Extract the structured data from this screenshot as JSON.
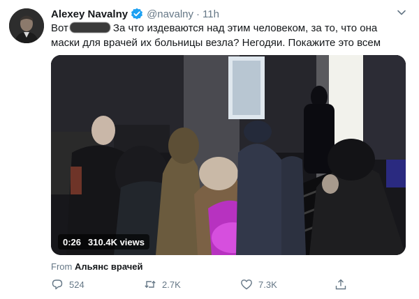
{
  "author": {
    "name": "Alexey Navalny",
    "handle": "@navalny",
    "separator": "·",
    "time": "11h"
  },
  "tweet": {
    "text_before_redaction": "Вот",
    "text_after_redaction": "За что издеваются над этим человеком, за то, что она маски для врачей их больницы везла? Негодяи. Покажите это всем"
  },
  "video": {
    "duration": "0:26",
    "views": "310.4K views"
  },
  "source": {
    "prefix": "From",
    "name": "Альянс врачей"
  },
  "actions": {
    "replies": "524",
    "retweets": "2.7K",
    "likes": "7.3K"
  },
  "icons": {
    "verified": "verified-badge-icon",
    "menu": "chevron-down-icon",
    "reply": "reply-icon",
    "retweet": "retweet-icon",
    "like": "heart-icon",
    "share": "share-icon"
  },
  "colors": {
    "verified": "#1da1f2",
    "muted": "#657786",
    "text": "#14171a"
  }
}
